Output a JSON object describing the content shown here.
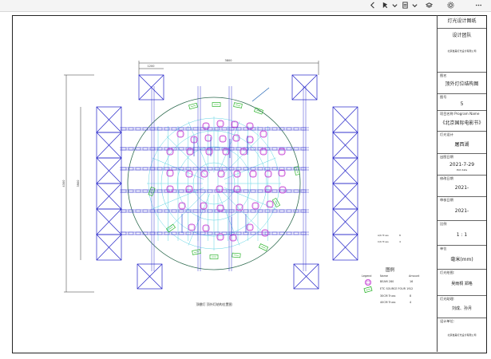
{
  "toolbar": {
    "icons": [
      "chevron-left-icon",
      "cursor-icon",
      "chevron-down-icon",
      "document-icon",
      "chevron-down-icon",
      "layers-icon",
      "settings-icon",
      "more-icon"
    ]
  },
  "drawing": {
    "caption": "顶棚灯  顶外灯结构位置图",
    "dims": {
      "top": "3800",
      "top_inner": "1200",
      "left": "4300",
      "left_inner": "3900"
    },
    "notes": [
      {
        "label": "A/K Truss",
        "value": "8"
      },
      {
        "label": "C/K Truss",
        "value": "4"
      }
    ]
  },
  "legend": {
    "title": "图例",
    "headers": [
      "Legend",
      "Name",
      "Amount"
    ],
    "rows": [
      {
        "icon": "lamp-magenta",
        "name": "BEAM 280",
        "amount": "16"
      },
      {
        "icon": "lamp-green",
        "name": "ETC SOURCE FOUR 19",
        "amount": "12"
      },
      {
        "icon": "truss-blue",
        "name": "30CM Truss",
        "amount": "8"
      },
      {
        "icon": "truss-blue",
        "name": "40CM Truss",
        "amount": "4"
      }
    ]
  },
  "title_block": {
    "company": "灯光设计图纸",
    "team_label": "设计团队",
    "team_sub": "北京舞美灯光设计有限公司",
    "drawing_name_label": "图名",
    "drawing_name": "顶外灯位结构图",
    "sheet_label": "图号",
    "sheet": "5",
    "project_label": "项目名称 Program Name",
    "project": "《北京国际电影节》",
    "designer_label": "灯光设计",
    "designer": "屠西湖",
    "date_label": "出图日期",
    "date": "2021-7-29",
    "date_sub": "Plot date",
    "version_label": "修改日期",
    "version": "2021-",
    "review_label": "审核日期",
    "review": "2021-",
    "scale_label": "比例",
    "scale": "1 : 1",
    "unit_label": "单位",
    "unit": "毫米(mm)",
    "drafter_label": "灯光绘图:",
    "drafter": "吴雨桐  郑格",
    "assistant_label": "灯光助理:",
    "assistant": "刘成、孙月",
    "address_label": "设计单位:",
    "address": "北京舞美灯光设计有限公司"
  }
}
